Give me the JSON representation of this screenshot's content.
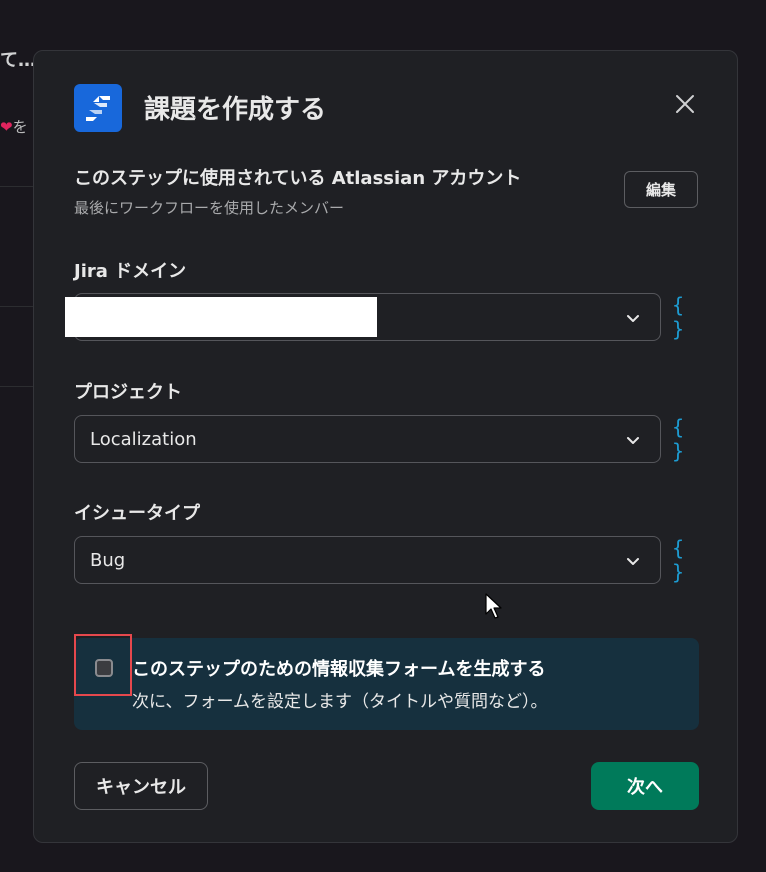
{
  "background": {
    "snippet_1": "て…",
    "snippet_2_heart": "❤",
    "snippet_2_text": "を"
  },
  "modal": {
    "title": "課題を作成する",
    "app_icon": "jira-logo-icon",
    "close_icon": "close-icon"
  },
  "account": {
    "heading": "このステップに使用されている Atlassian アカウント",
    "subtext": "最後にワークフローを使用したメンバー",
    "edit_label": "編集"
  },
  "fields": {
    "jira_domain": {
      "label": "Jira ドメイン",
      "value": ""
    },
    "project": {
      "label": "プロジェクト",
      "value": "Localization"
    },
    "issue_type": {
      "label": "イシュータイプ",
      "value": "Bug"
    },
    "variable_icon_text": "{}"
  },
  "form_option": {
    "checked": false,
    "title": "このステップのための情報収集フォームを生成する",
    "subtitle": "次に、フォームを設定します（タイトルや質問など）。"
  },
  "footer": {
    "cancel_label": "キャンセル",
    "next_label": "次へ"
  },
  "colors": {
    "accent_primary": "#007a5a",
    "variable_link": "#1d9bd1",
    "jira_blue": "#1868db",
    "info_panel": "#16303e",
    "highlight": "#e5484d"
  }
}
